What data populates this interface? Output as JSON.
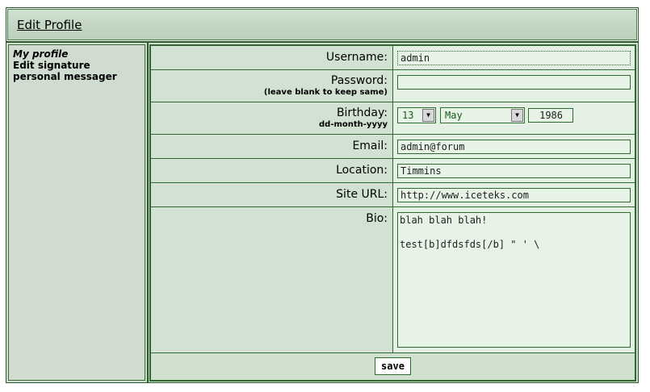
{
  "header": {
    "title": "Edit Profile"
  },
  "sidebar": {
    "items": [
      {
        "label": "My profile"
      },
      {
        "label": "Edit signature"
      },
      {
        "label": "personal messager"
      }
    ]
  },
  "form": {
    "username": {
      "label": "Username:",
      "value": "admin"
    },
    "password": {
      "label": "Password:",
      "hint": "(leave blank to keep same)",
      "value": ""
    },
    "birthday": {
      "label": "Birthday:",
      "hint": "dd-month-yyyy",
      "day": "13",
      "month": "May",
      "year": "1986"
    },
    "email": {
      "label": "Email:",
      "value": "admin@forum"
    },
    "location": {
      "label": "Location:",
      "value": "Timmins"
    },
    "site_url": {
      "label": "Site URL:",
      "value": "http://www.iceteks.com"
    },
    "bio": {
      "label": "Bio:",
      "value": "blah blah blah!\n\ntest[b]dfdsfds[/b] \" ' \\"
    },
    "save_label": "save"
  },
  "icons": {
    "dropdown": "chevron-down-icon"
  }
}
